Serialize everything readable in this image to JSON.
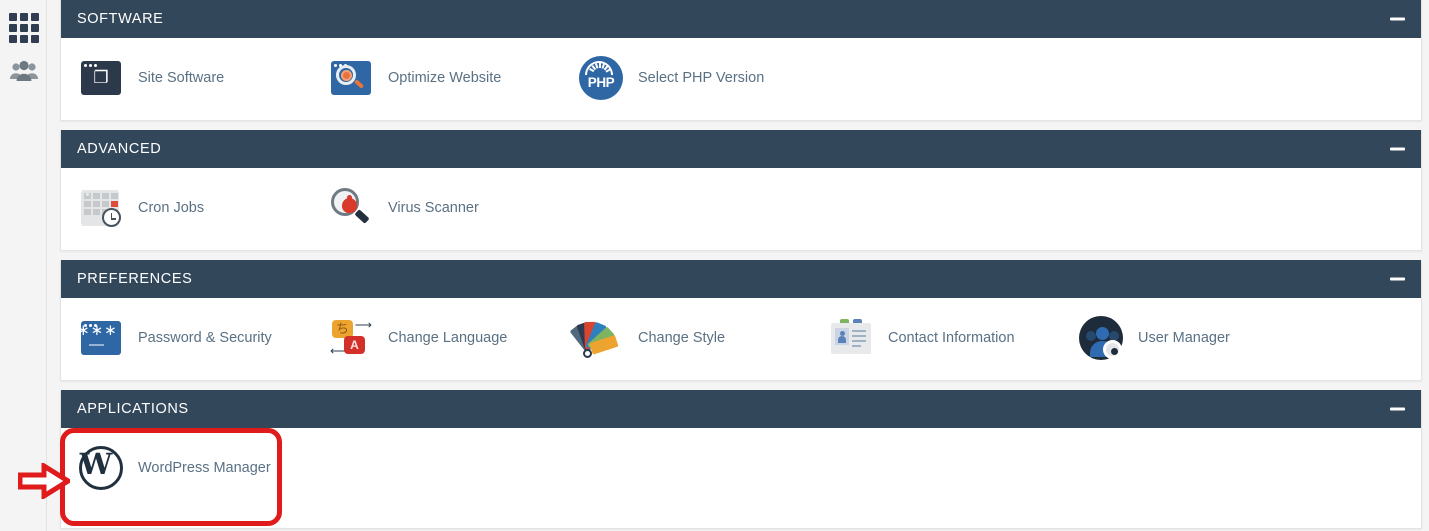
{
  "sidebar": {
    "items": [
      {
        "name": "apps-grid",
        "icon": "grid-icon",
        "label": ""
      },
      {
        "name": "user-manager",
        "icon": "users-icon",
        "label": ""
      }
    ]
  },
  "sections": [
    {
      "id": "software",
      "title": "SOFTWARE",
      "collapse_label": "−",
      "items": [
        {
          "label": "Site Software",
          "icon": "puzzle-window-icon"
        },
        {
          "label": "Optimize Website",
          "icon": "magnifier-gear-window-icon"
        },
        {
          "label": "Select PHP Version",
          "icon": "php-gauge-icon",
          "icon_text": "PHP"
        }
      ]
    },
    {
      "id": "advanced",
      "title": "ADVANCED",
      "collapse_label": "−",
      "items": [
        {
          "label": "Cron Jobs",
          "icon": "calendar-clock-icon"
        },
        {
          "label": "Virus Scanner",
          "icon": "magnifier-bug-icon"
        }
      ]
    },
    {
      "id": "preferences",
      "title": "PREFERENCES",
      "collapse_label": "−",
      "items": [
        {
          "label": "Password & Security",
          "icon": "password-window-icon",
          "icon_text": "∗∗∗—"
        },
        {
          "label": "Change Language",
          "icon": "speech-bubbles-icon",
          "icon_text_1": "ち",
          "icon_text_2": "A"
        },
        {
          "label": "Change Style",
          "icon": "color-swatch-fan-icon"
        },
        {
          "label": "Contact Information",
          "icon": "id-card-icon"
        },
        {
          "label": "User Manager",
          "icon": "people-gear-icon"
        }
      ]
    },
    {
      "id": "applications",
      "title": "APPLICATIONS",
      "collapse_label": "−",
      "items": [
        {
          "label": "WordPress Manager",
          "icon": "wordpress-icon",
          "icon_text": "W"
        }
      ]
    }
  ],
  "annotation": {
    "type": "highlight-box-with-arrow",
    "target": "WordPress Manager",
    "color": "#e01b1b"
  },
  "colors": {
    "header_bg": "#33475b",
    "panel_bg": "#ffffff",
    "page_bg": "#f4f4f4",
    "link_text": "#5a7184",
    "annotation_red": "#e01b1b"
  }
}
